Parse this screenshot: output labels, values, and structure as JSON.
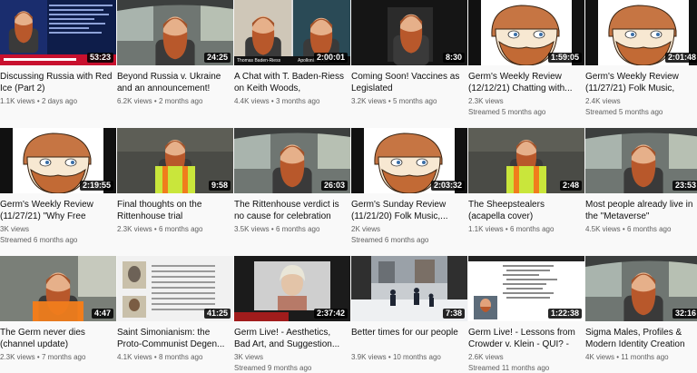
{
  "videos": [
    {
      "title": "Discussing Russia with Red Ice (Part 2)",
      "duration": "53:23",
      "views": "1.1K views",
      "ago": "2 days ago",
      "extra": "",
      "thumb": "banner"
    },
    {
      "title": "Beyond Russia v. Ukraine and an announcement!",
      "duration": "24:25",
      "views": "6.2K views",
      "ago": "2 months ago",
      "extra": "",
      "thumb": "car"
    },
    {
      "title": "A Chat with T. Baden-Riess on Keith Woods, Rothschild...",
      "duration": "2:00:01",
      "views": "4.4K views",
      "ago": "3 months ago",
      "extra": "",
      "thumb": "split",
      "overlay_left": "Thomas Baden-Riess",
      "overlay_right": "Apollonian Intel"
    },
    {
      "title": "Coming Soon! Vaccines as Legislated Transhumanism...",
      "duration": "8:30",
      "views": "3.2K views",
      "ago": "5 months ago",
      "extra": "",
      "thumb": "dark"
    },
    {
      "title": "Germ's Weekly Review (12/12/21) Chatting with...",
      "duration": "1:59:05",
      "views": "2.3K views",
      "ago": "",
      "extra": "Streamed 5 months ago",
      "thumb": "cartoon"
    },
    {
      "title": "Germ's Weekly Review (11/27/21) Folk Music, \"The...",
      "duration": "2:01:48",
      "views": "2.4K views",
      "ago": "",
      "extra": "Streamed 5 months ago",
      "thumb": "cartoon"
    },
    {
      "title": "Germ's Weekly Review (11/27/21) \"Why Free Porn?...",
      "duration": "2:19:55",
      "views": "3K views",
      "ago": "",
      "extra": "Streamed 6 months ago",
      "thumb": "cartoon"
    },
    {
      "title": "Final thoughts on the Rittenhouse trial (addendu...",
      "duration": "9:58",
      "views": "2.3K views",
      "ago": "6 months ago",
      "extra": "",
      "thumb": "vest"
    },
    {
      "title": "The Rittenhouse verdict is no cause for celebration",
      "duration": "26:03",
      "views": "3.5K views",
      "ago": "6 months ago",
      "extra": "",
      "thumb": "car"
    },
    {
      "title": "Germ's Sunday Review (11/21/20) Folk Music,...",
      "duration": "2:03:32",
      "views": "2K views",
      "ago": "",
      "extra": "Streamed 6 months ago",
      "thumb": "cartoon"
    },
    {
      "title": "The Sheepstealers (acapella cover)",
      "duration": "2:48",
      "views": "1.1K views",
      "ago": "6 months ago",
      "extra": "",
      "thumb": "vest"
    },
    {
      "title": "Most people already live in the \"Metaverse\"",
      "duration": "23:53",
      "views": "4.5K views",
      "ago": "6 months ago",
      "extra": "",
      "thumb": "car"
    },
    {
      "title": "The Germ never dies (channel update)",
      "duration": "4:47",
      "views": "2.3K views",
      "ago": "7 months ago",
      "extra": "",
      "thumb": "vestcar"
    },
    {
      "title": "Saint Simonianism: the Proto-Communist Degen...",
      "duration": "41:25",
      "views": "4.1K views",
      "ago": "8 months ago",
      "extra": "",
      "thumb": "doc"
    },
    {
      "title": "Germ Live! - Aesthetics, Bad Art, and Suggestion...",
      "duration": "2:37:42",
      "views": "3K views",
      "ago": "",
      "extra": "Streamed 9 months ago",
      "thumb": "stream"
    },
    {
      "title": "Better times for our people",
      "duration": "7:38",
      "views": "3.9K views",
      "ago": "10 months ago",
      "extra": "",
      "thumb": "snow"
    },
    {
      "title": "Germ Live! - Lessons from Crowder v. Klein - QUI? - CR...",
      "duration": "1:22:38",
      "views": "2.6K views",
      "ago": "",
      "extra": "Streamed 11 months ago",
      "thumb": "browser"
    },
    {
      "title": "Sigma Males, Profiles & Modern Identity Creation",
      "duration": "32:16",
      "views": "4K views",
      "ago": "11 months ago",
      "extra": "",
      "thumb": "car"
    }
  ],
  "colors": {
    "background": "#f9f9f9",
    "title": "#0f0f0f",
    "meta": "#606060",
    "duration_bg": "#000000"
  }
}
